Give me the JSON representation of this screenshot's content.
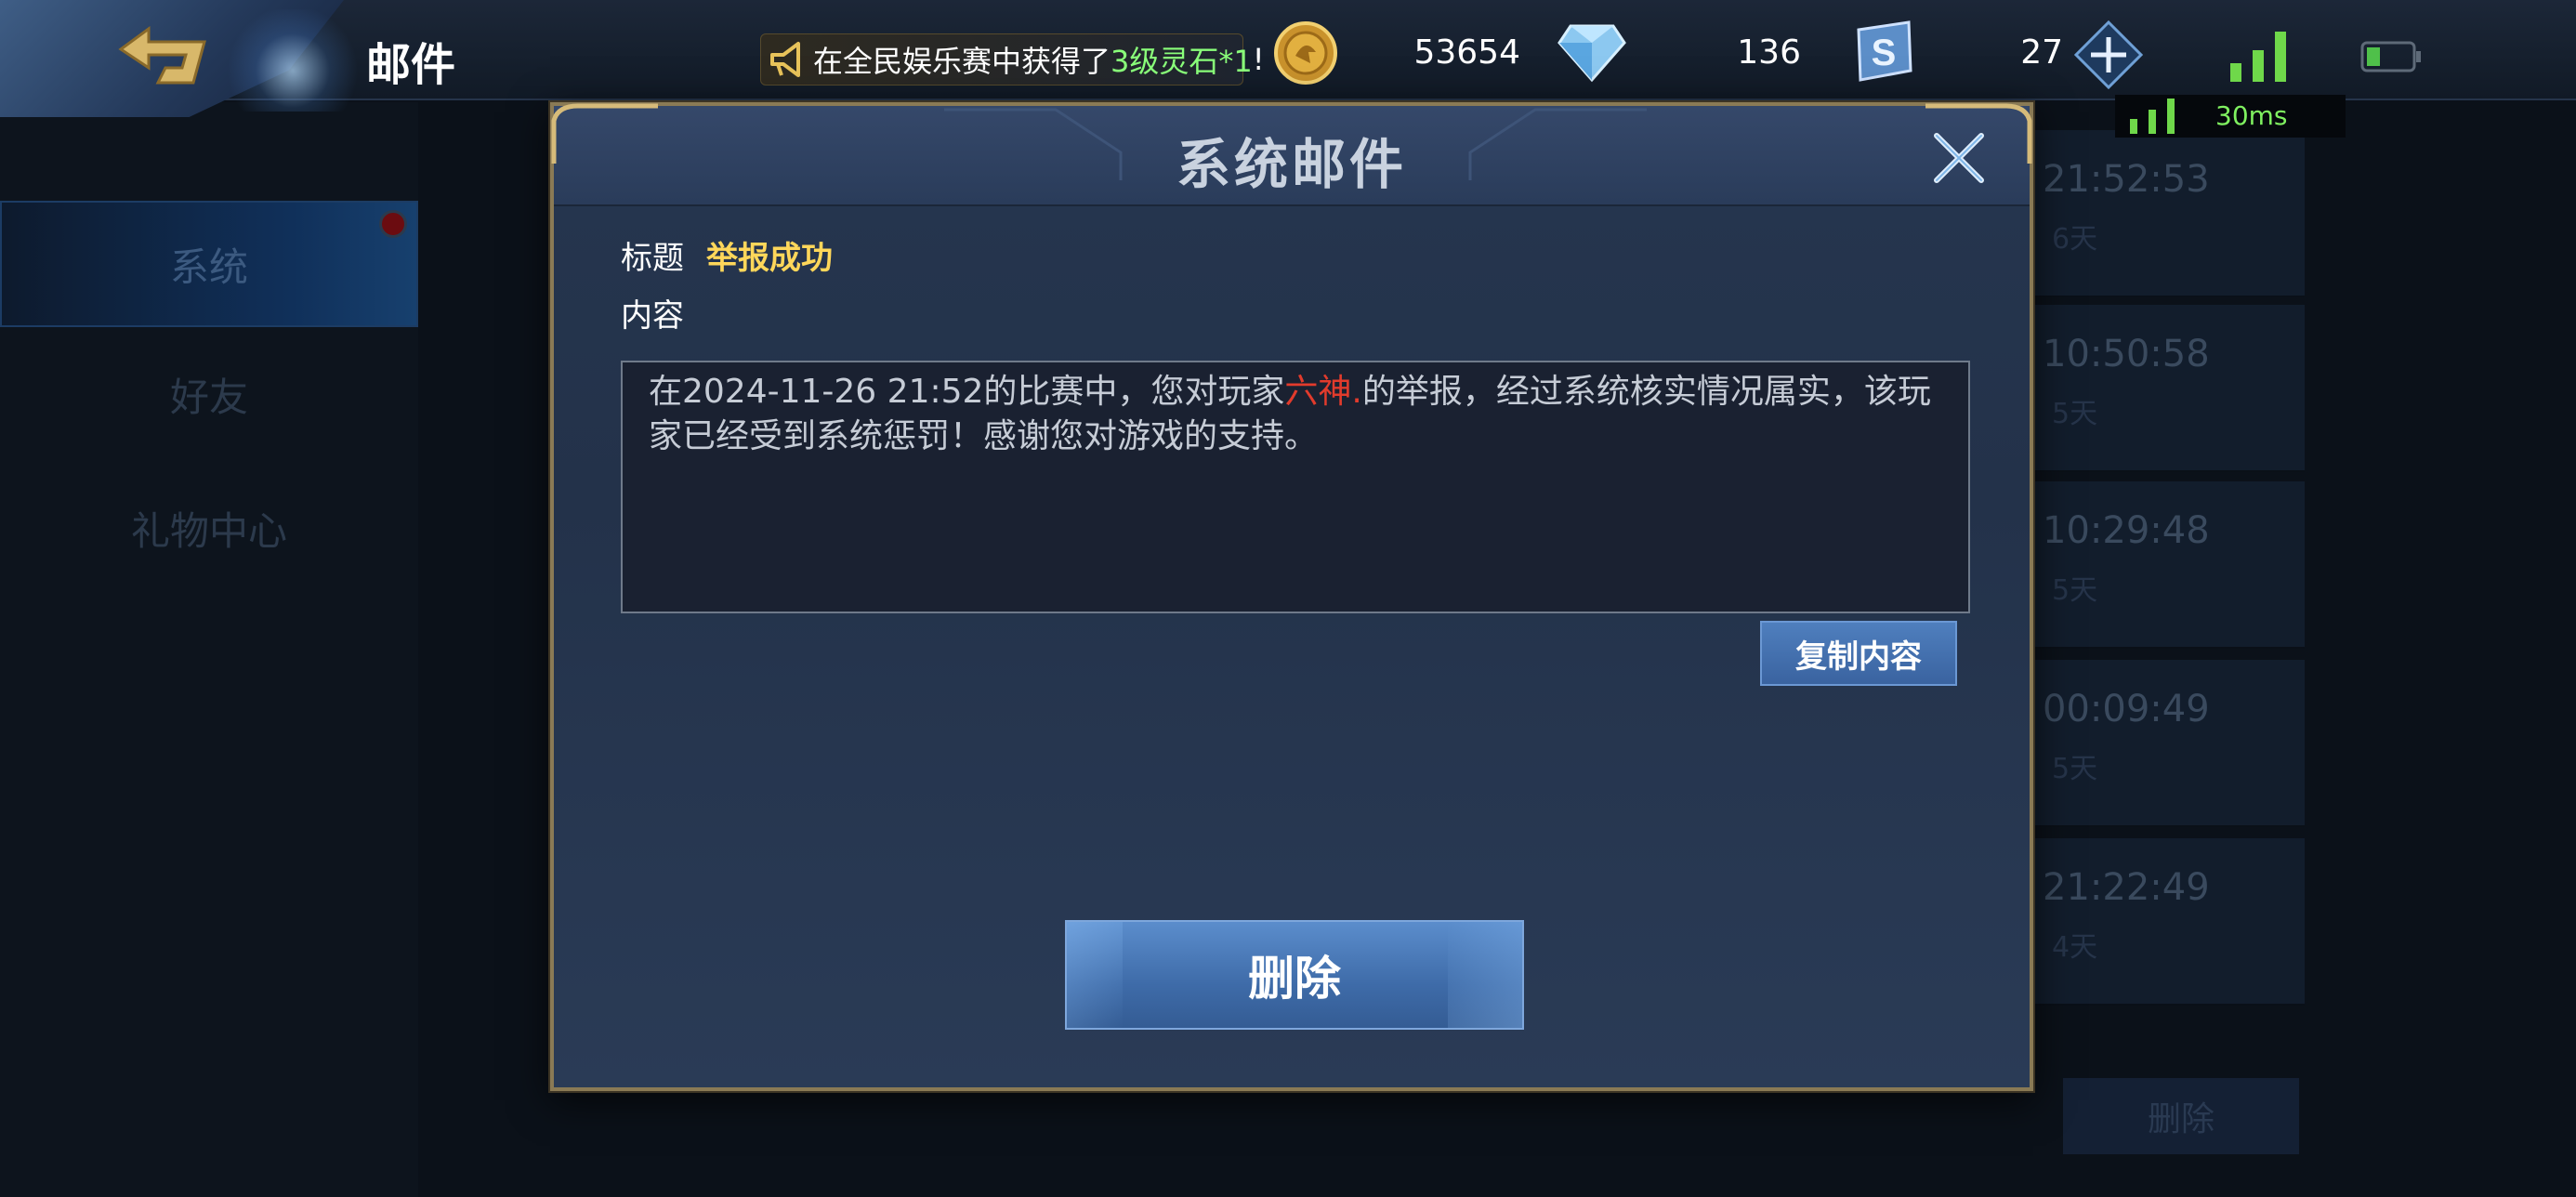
{
  "header": {
    "title": "邮件",
    "notice": {
      "prefix": "在全民娱乐赛中获得了",
      "highlight": "3级灵石*1",
      "suffix": "!"
    },
    "currencies": {
      "gold": "53654",
      "diamond": "136",
      "ticket": "27"
    },
    "ping": "30ms",
    "colors": {
      "notice_highlight": "#8aff7a",
      "ping": "#7ff060"
    }
  },
  "background": {
    "sidebar_tabs": [
      "系统",
      "好友",
      "礼物中心"
    ],
    "mail_items": [
      {
        "time": "21:52:53",
        "days": "6天"
      },
      {
        "time": "10:50:58",
        "days": "5天"
      },
      {
        "time": "10:29:48",
        "days": "5天"
      },
      {
        "time": "00:09:49",
        "days": "5天"
      },
      {
        "time": "21:22:49",
        "days": "4天"
      }
    ],
    "delete_label": "删除"
  },
  "modal": {
    "title": "系统邮件",
    "subject_label": "标题",
    "subject_value": "举报成功",
    "content_label": "内容",
    "content_before": "在2024-11-26 21:52的比赛中，您对玩家",
    "content_player": "六神.",
    "content_after": "的举报，经过系统核实情况属实，该玩家已经受到系统惩罚！感谢您对游戏的支持。",
    "copy_label": "复制内容",
    "delete_label": "删除",
    "colors": {
      "subject": "#ffd75a",
      "player": "#e23b2c",
      "border_gold": "#8a7a55"
    }
  },
  "icons": [
    "back-icon",
    "megaphone-icon",
    "gold-coin-icon",
    "diamond-icon",
    "ticket-icon",
    "plus-icon",
    "signal-icon",
    "battery-icon",
    "close-icon"
  ]
}
